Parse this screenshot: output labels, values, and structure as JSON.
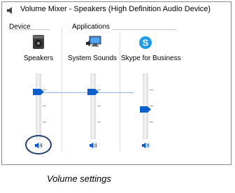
{
  "window": {
    "title": "Volume Mixer - Speakers (High Definition Audio Device)",
    "title_icon": "speaker-icon"
  },
  "device_section": {
    "label": "Device",
    "device_name": "Speakers",
    "icon": "speaker-device-icon",
    "volume_fraction": 0.74,
    "mute_icon": "volume-icon"
  },
  "applications_section": {
    "label": "Applications",
    "apps": [
      {
        "name": "System Sounds",
        "icon": "system-sounds-icon",
        "volume_fraction": 0.74,
        "mute_icon": "volume-icon"
      },
      {
        "name": "Skype for Business",
        "icon": "skype-icon",
        "volume_fraction": 0.45,
        "mute_icon": "volume-icon"
      }
    ]
  },
  "caption": "Volume settings",
  "colors": {
    "thumb": "#0b5fcc",
    "highlight": "#1f3f75",
    "skype": "#1e9be6"
  }
}
